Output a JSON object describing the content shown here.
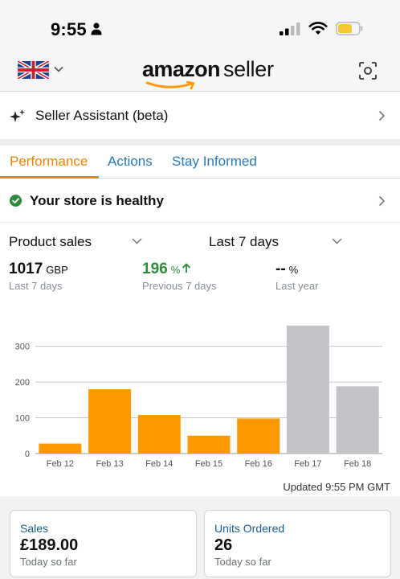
{
  "status_bar": {
    "time": "9:55"
  },
  "header": {
    "brand_amazon": "amazon",
    "brand_seller": "seller"
  },
  "assistant": {
    "label": "Seller Assistant (beta)"
  },
  "tabs": [
    {
      "label": "Performance",
      "active": true
    },
    {
      "label": "Actions",
      "active": false
    },
    {
      "label": "Stay Informed",
      "active": false
    }
  ],
  "health": {
    "label": "Your store is healthy"
  },
  "filters": {
    "metric": "Product sales",
    "period": "Last 7 days"
  },
  "metrics": [
    {
      "value": "1017",
      "unit": "GBP",
      "caption": "Last 7 days"
    },
    {
      "value": "196",
      "unit": "%",
      "caption": "Previous 7 days",
      "trend": "up"
    },
    {
      "value": "--",
      "unit": "%",
      "caption": "Last year"
    }
  ],
  "chart_data": {
    "type": "bar",
    "categories": [
      "Feb 12",
      "Feb 13",
      "Feb 14",
      "Feb 15",
      "Feb 16",
      "Feb 17",
      "Feb 18"
    ],
    "values": [
      28,
      180,
      108,
      50,
      98,
      358,
      188
    ],
    "bar_colors": [
      "#ff9900",
      "#ff9900",
      "#ff9900",
      "#ff9900",
      "#ff9900",
      "#c4c4c8",
      "#c4c4c8"
    ],
    "ylim": [
      0,
      360
    ],
    "yticks": [
      0,
      100,
      200,
      300
    ],
    "grid": true,
    "title": "",
    "xlabel": "",
    "ylabel": ""
  },
  "updated": "Updated 9:55 PM GMT",
  "cards": [
    {
      "title": "Sales",
      "value": "£189.00",
      "sub": "Today so far"
    },
    {
      "title": "Units Ordered",
      "value": "26",
      "sub": "Today so far"
    }
  ],
  "colors": {
    "accent": "#e8860b",
    "link": "#2a7ab8",
    "positive": "#2e8b3c"
  }
}
